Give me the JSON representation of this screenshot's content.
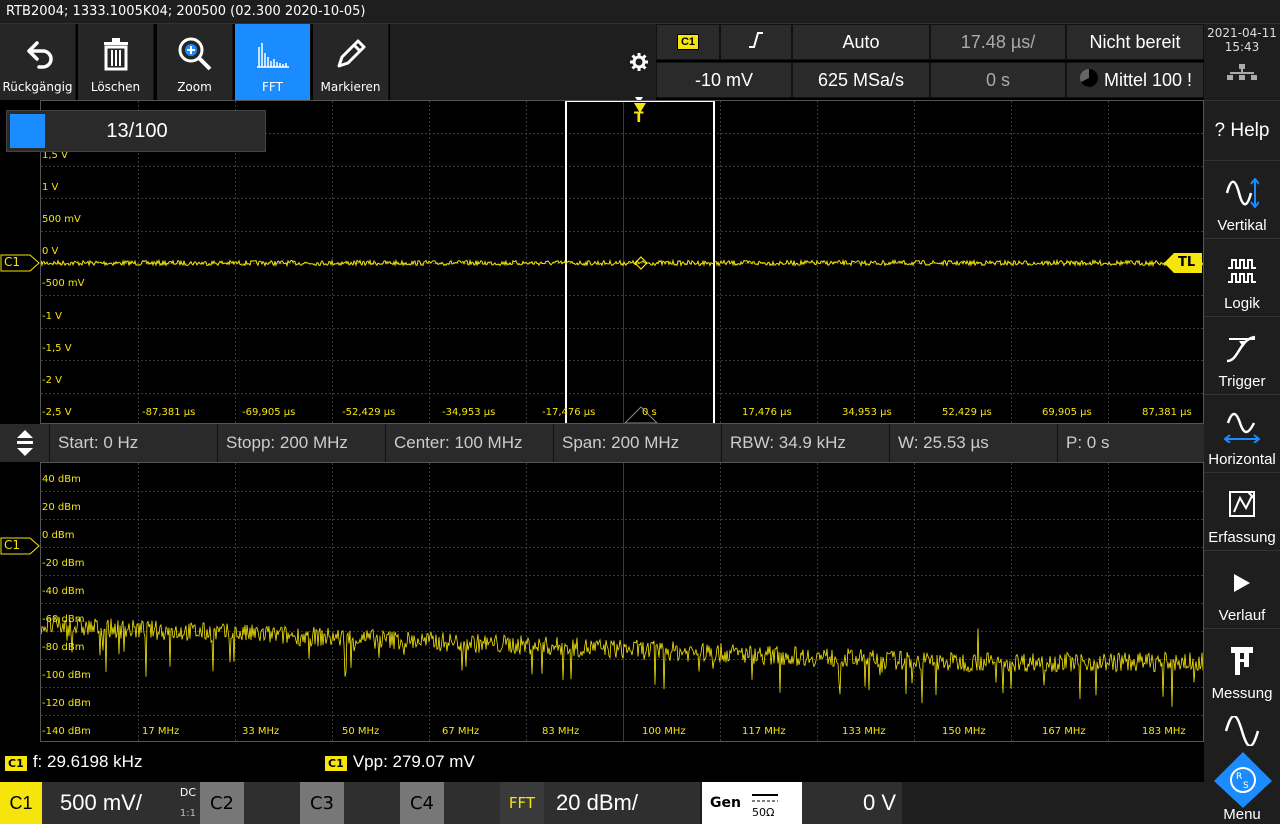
{
  "title": "RTB2004; 1333.1005K04; 200500 (02.300 2020-10-05)",
  "toolbar": [
    {
      "label": "Rückgängig",
      "icon": "undo-icon"
    },
    {
      "label": "Löschen",
      "icon": "trash-icon"
    },
    {
      "label": "Zoom",
      "icon": "zoom-icon"
    },
    {
      "label": "FFT",
      "icon": "fft-icon",
      "active": true
    },
    {
      "label": "Markieren",
      "icon": "pencil-icon"
    }
  ],
  "status": {
    "channel": "C1",
    "level": "-10 mV",
    "mode": "Auto",
    "sample_rate": "625 MSa/s",
    "timebase": "17.48 µs/",
    "position": "0 s",
    "trigger_state": "Nicht bereit",
    "average": "Mittel 100 !"
  },
  "datetime": {
    "date": "2021-04-11",
    "time": "15:43"
  },
  "counter": "13/100",
  "time_plot": {
    "y_labels": [
      "1,5 V",
      "1 V",
      "500 mV",
      "0 V",
      "-500 mV",
      "-1 V",
      "-1,5 V",
      "-2 V",
      "-2,5 V"
    ],
    "x_labels": [
      "-87,381 µs",
      "-69,905 µs",
      "-52,429 µs",
      "-34,953 µs",
      "-17,476 µs",
      "0 s",
      "17,476 µs",
      "34,953 µs",
      "52,429 µs",
      "69,905 µs",
      "87,381 µs"
    ],
    "trigger_marker": "T",
    "trigger_level_label": "TL",
    "channel_marker": "C1"
  },
  "fft_bar": {
    "start": "Start: 0 Hz",
    "stop": "Stopp: 200 MHz",
    "center": "Center: 100 MHz",
    "span": "Span: 200 MHz",
    "rbw": "RBW: 34.9 kHz",
    "window": "W: 25.53 µs",
    "position": "P: 0 s"
  },
  "fft_plot": {
    "y_labels": [
      "40 dBm",
      "20 dBm",
      "0 dBm",
      "-20 dBm",
      "-40 dBm",
      "-60 dBm",
      "-80 dBm",
      "-100 dBm",
      "-120 dBm",
      "-140 dBm"
    ],
    "x_labels": [
      "17 MHz",
      "33 MHz",
      "50 MHz",
      "67 MHz",
      "83 MHz",
      "100 MHz",
      "117 MHz",
      "133 MHz",
      "150 MHz",
      "167 MHz",
      "183 MHz"
    ],
    "channel_marker": "C1"
  },
  "measurements": [
    {
      "channel": "C1",
      "text": "f: 29.6198 kHz"
    },
    {
      "channel": "C1",
      "text": "Vpp: 279.07 mV"
    }
  ],
  "sidebar": [
    {
      "label": "? Help",
      "icon": "help-icon"
    },
    {
      "label": "Vertikal",
      "icon": "vertical-icon"
    },
    {
      "label": "Logik",
      "icon": "logic-icon"
    },
    {
      "label": "Trigger",
      "icon": "trigger-icon"
    },
    {
      "label": "Horizontal",
      "icon": "horizontal-icon"
    },
    {
      "label": "Erfassung",
      "icon": "acquisition-icon"
    },
    {
      "label": "Verlauf",
      "icon": "play-icon"
    },
    {
      "label": "Messung",
      "icon": "measure-icon"
    },
    {
      "label": "Menu",
      "icon": "rs-logo-icon"
    }
  ],
  "channels": {
    "c1": {
      "label": "C1",
      "scale": "500 mV/",
      "coupling": "DC",
      "impedance": "1:1"
    },
    "c2": {
      "label": "C2"
    },
    "c3": {
      "label": "C3"
    },
    "c4": {
      "label": "C4"
    },
    "fft": {
      "label": "FFT",
      "scale": "20 dBm/"
    },
    "gen": {
      "label": "Gen",
      "impedance": "50Ω",
      "value": "0 V"
    }
  },
  "colors": {
    "trace": "#f5e50b",
    "accent": "#1a8cff",
    "grid": "#3a3a3a"
  }
}
